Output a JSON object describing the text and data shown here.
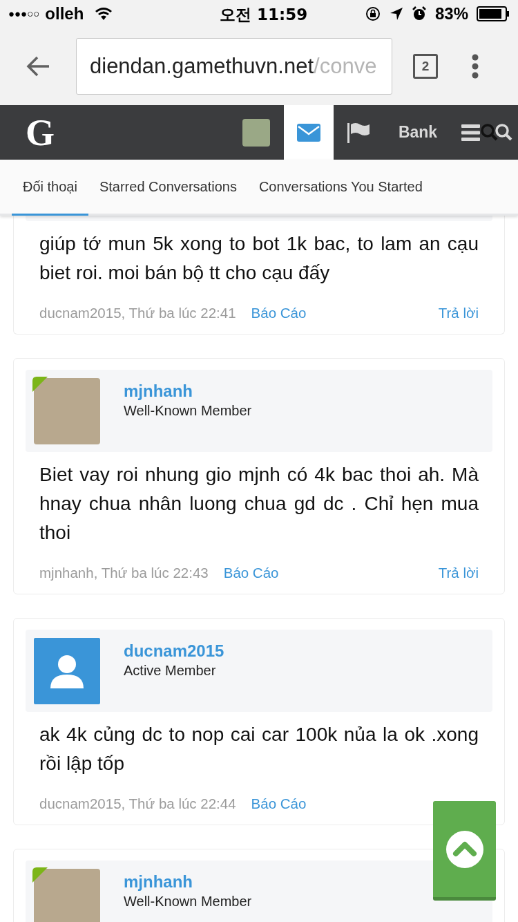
{
  "status_bar": {
    "signal": "●●●○○",
    "carrier": "olleh",
    "time": "오전 11:59",
    "battery": "83%"
  },
  "browser": {
    "url_host": "diendan.gamethuvn.net",
    "url_path": "/conve",
    "tab_count": "2"
  },
  "nav": {
    "logo": "G",
    "items": [
      {
        "kind": "avatar",
        "selected": false
      },
      {
        "kind": "mail",
        "selected": true
      },
      {
        "kind": "flag",
        "selected": false
      },
      {
        "kind": "text",
        "label": "Bank",
        "selected": false
      },
      {
        "kind": "menu",
        "selected": false
      },
      {
        "kind": "search",
        "selected": false
      }
    ]
  },
  "tabs": [
    {
      "label": "Đối thoại",
      "selected": true
    },
    {
      "label": "Starred Conversations",
      "selected": false
    },
    {
      "label": "Conversations You Started",
      "selected": false
    }
  ],
  "posts": [
    {
      "message": "giúp tớ mun 5k xong to bot 1k bac, to lam an cạu biet roi. moi bán bộ tt cho cạu đấy",
      "author_line": "ducnam2015, Thứ ba lúc 22:41",
      "report": "Báo Cáo",
      "reply": "Trả lời"
    },
    {
      "author": {
        "name": "mjnhanh",
        "role": "Well-Known Member",
        "kind": "photo",
        "online": true
      },
      "message": "Biet vay roi nhung gio mjnh có 4k bac thoi ah. Mà hnay chua nhân luong chua gd dc . Chỉ hẹn mua thoi",
      "author_line": "mjnhanh, Thứ ba lúc 22:43",
      "report": "Báo Cáo",
      "reply": "Trả lời"
    },
    {
      "author": {
        "name": "ducnam2015",
        "role": "Active Member",
        "kind": "default",
        "online": false
      },
      "message": "ak 4k củng dc to nop cai car 100k nủa la ok .xong rồi lập tốp",
      "author_line": "ducnam2015, Thứ ba lúc 22:44",
      "report": "Báo Cáo"
    },
    {
      "author": {
        "name": "mjnhanh",
        "role": "Well-Known Member",
        "kind": "photo",
        "online": true
      }
    }
  ]
}
